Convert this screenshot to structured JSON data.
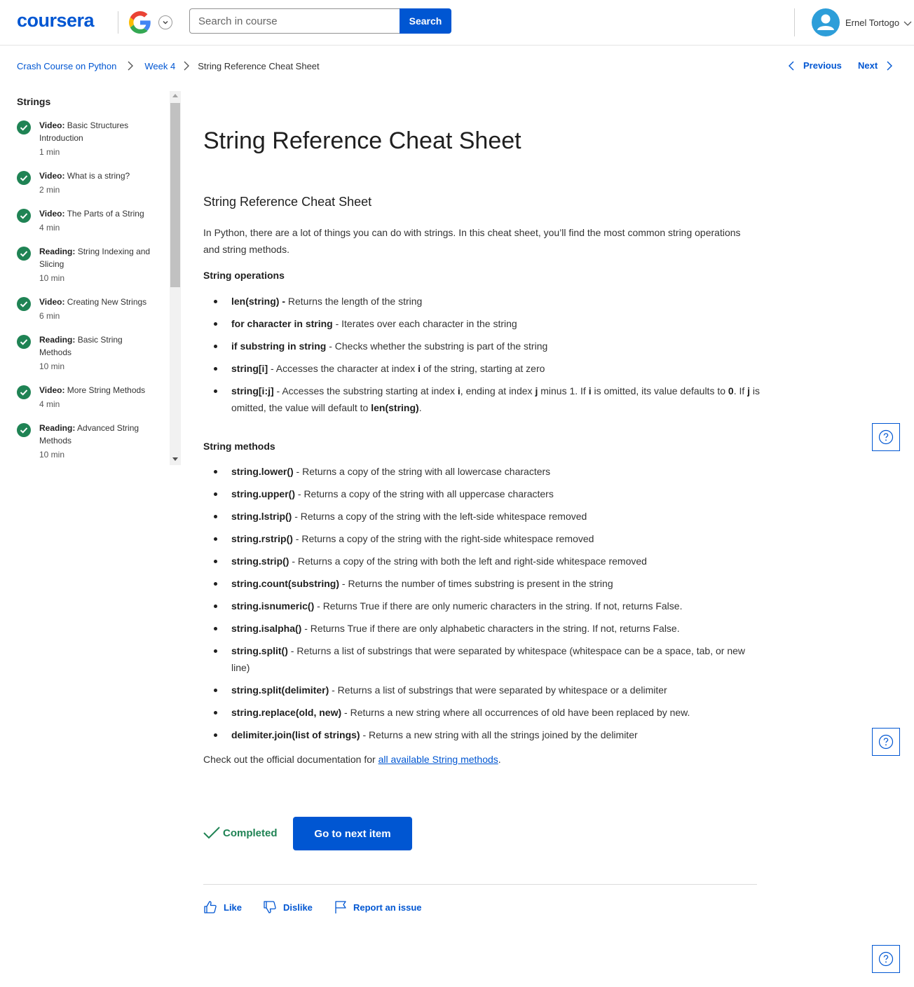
{
  "header": {
    "logo_text": "coursera",
    "search_placeholder": "Search in course",
    "search_button": "Search",
    "user_name": "Ernel Tortogo"
  },
  "breadcrumb": {
    "course": "Crash Course on Python",
    "week": "Week 4",
    "current": "String Reference Cheat Sheet"
  },
  "nav": {
    "previous": "Previous",
    "next": "Next"
  },
  "sidebar": {
    "title": "Strings",
    "items": [
      {
        "type": "Video:",
        "title": "Basic Structures Introduction",
        "duration": "1 min"
      },
      {
        "type": "Video:",
        "title": "What is a string?",
        "duration": "2 min"
      },
      {
        "type": "Video:",
        "title": "The Parts of a String",
        "duration": "4 min"
      },
      {
        "type": "Reading:",
        "title": "String Indexing and Slicing",
        "duration": "10 min"
      },
      {
        "type": "Video:",
        "title": "Creating New Strings",
        "duration": "6 min"
      },
      {
        "type": "Reading:",
        "title": "Basic String Methods",
        "duration": "10 min"
      },
      {
        "type": "Video:",
        "title": "More String Methods",
        "duration": "4 min"
      },
      {
        "type": "Reading:",
        "title": "Advanced String Methods",
        "duration": "10 min"
      }
    ]
  },
  "main": {
    "title": "String Reference Cheat Sheet",
    "subtitle": "String Reference Cheat Sheet",
    "intro": "In Python, there are a lot of things you can do with strings. In this cheat sheet, you’ll find the most common string operations and string methods.",
    "operations_heading": "String operations",
    "operations": [
      {
        "code": "len(string) -",
        "desc": " Returns the length of the string"
      },
      {
        "code": "for character in string",
        "desc": " - Iterates over each character in the string"
      },
      {
        "code": "if substring in string",
        "desc": " - Checks whether the substring is part of the string"
      },
      {
        "code": "string[i]",
        "desc": " - Accesses the character at index ",
        "b1": "i",
        "desc2": " of the string, starting at zero"
      },
      {
        "code": "string[i:j]",
        "desc": " - Accesses the substring starting at index ",
        "b1": "i",
        "desc2": ", ending at index ",
        "b2": "j",
        "desc3": " minus 1. If ",
        "b3": "i",
        "desc4": " is omitted, its value defaults to ",
        "b4": "0",
        "desc5": ". If ",
        "b5": "j",
        "desc6": " is omitted, the value will default to ",
        "b6": "len(string)",
        "desc7": "."
      }
    ],
    "methods_heading": "String methods",
    "methods": [
      {
        "code": "string.lower()",
        "desc": " - Returns a copy of the string with all lowercase characters"
      },
      {
        "code": "string.upper()",
        "desc": " - Returns a copy of the string with all uppercase characters"
      },
      {
        "code": "string.lstrip()",
        "desc": " - Returns a copy of the string with the left-side whitespace removed"
      },
      {
        "code": "string.rstrip()",
        "desc": " - Returns a copy of the string with the right-side whitespace removed"
      },
      {
        "code": "string.strip()",
        "desc": " - Returns a copy of the string with both the left and right-side whitespace removed"
      },
      {
        "code": "string.count(substring)",
        "desc": " - Returns the number of times substring is present in the string"
      },
      {
        "code": "string.isnumeric()",
        "desc": " - Returns True if there are only numeric characters in the string. If not, returns False."
      },
      {
        "code": "string.isalpha()",
        "desc": " - Returns True if there are only alphabetic characters in the string. If not, returns False."
      },
      {
        "code": "string.split()",
        "desc": " - Returns a list of substrings that were separated by whitespace (whitespace can be a space, tab, or new line)"
      },
      {
        "code": "string.split(delimiter)",
        "desc": " - Returns a list of substrings that were separated by whitespace or a delimiter"
      },
      {
        "code": "string.replace(old, new)",
        "desc": " - Returns a new string where all occurrences of old have been replaced by new."
      },
      {
        "code": "delimiter.join(list of strings)",
        "desc": " - Returns a new string with all the strings joined by the delimiter"
      }
    ],
    "docs_prefix": "Check out the official documentation for ",
    "docs_link": "all available String methods",
    "docs_suffix": ".",
    "completed_label": "Completed",
    "next_item_button": "Go to next item"
  },
  "feedback": {
    "like": "Like",
    "dislike": "Dislike",
    "report": "Report an issue"
  },
  "colors": {
    "brand": "#0056d2",
    "complete_green": "#1f8354"
  }
}
